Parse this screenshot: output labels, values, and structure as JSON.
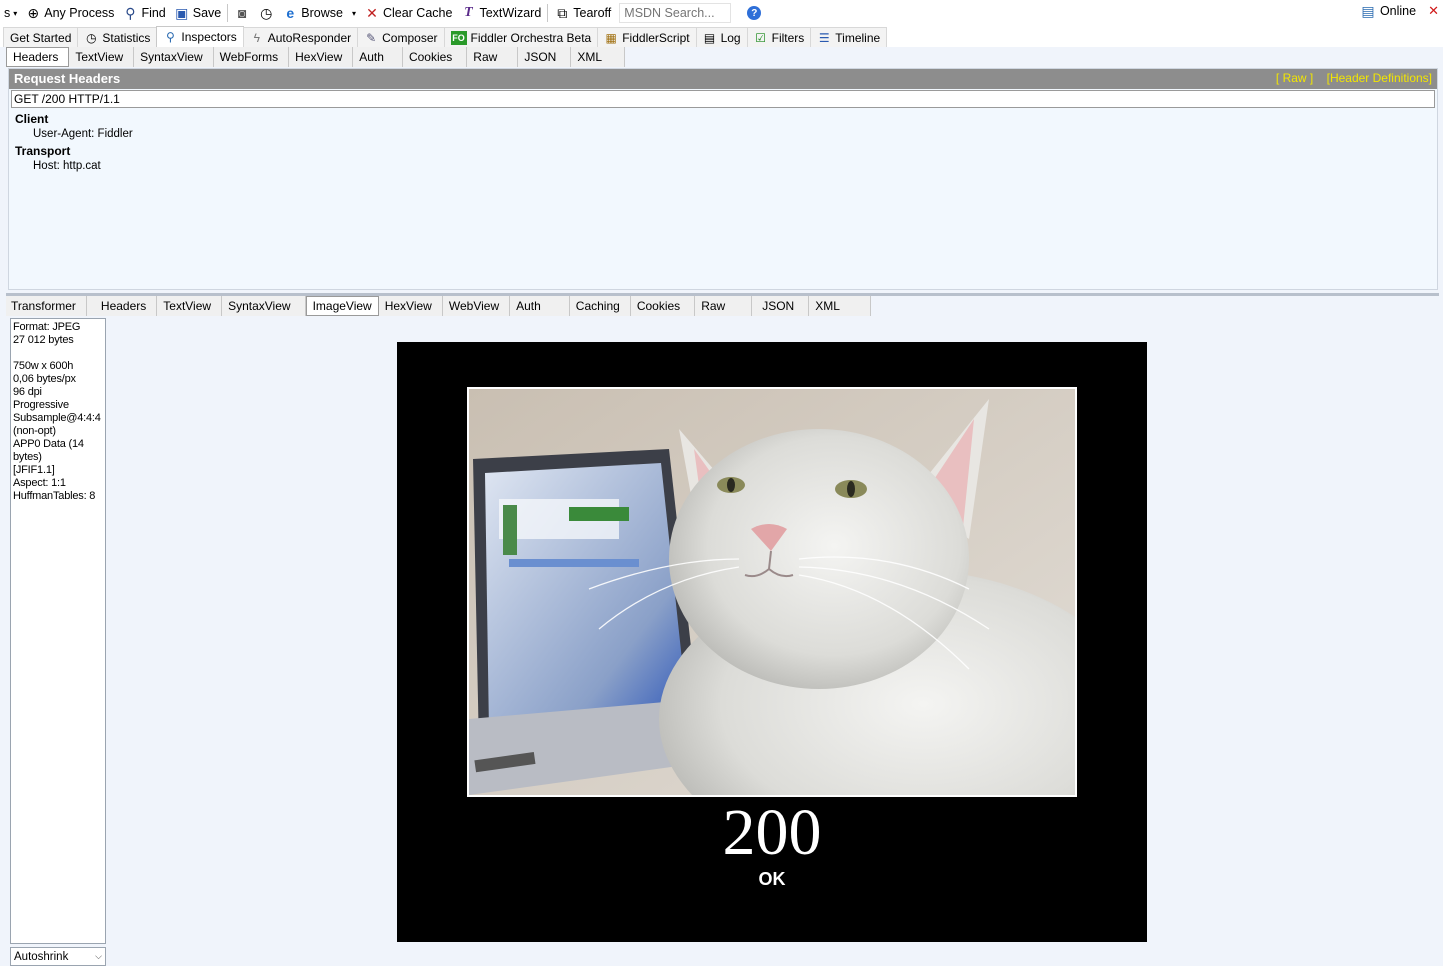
{
  "toolbar": {
    "cut_label": "s",
    "any_process": "Any Process",
    "find": "Find",
    "save": "Save",
    "browse": "Browse",
    "clear_cache": "Clear Cache",
    "text_wizard": "TextWizard",
    "tearoff": "Tearoff",
    "msdn_placeholder": "MSDN Search...",
    "online": "Online"
  },
  "main_tabs": [
    {
      "label": "Get Started"
    },
    {
      "label": "Statistics"
    },
    {
      "label": "Inspectors"
    },
    {
      "label": "AutoResponder"
    },
    {
      "label": "Composer"
    },
    {
      "label": "Fiddler Orchestra Beta",
      "icon": "FO"
    },
    {
      "label": "FiddlerScript"
    },
    {
      "label": "Log"
    },
    {
      "label": "Filters"
    },
    {
      "label": "Timeline"
    }
  ],
  "active_main_tab": "Inspectors",
  "request_tabs": [
    "Headers",
    "TextView",
    "SyntaxView",
    "WebForms",
    "HexView",
    "Auth",
    "Cookies",
    "Raw",
    "JSON",
    "XML"
  ],
  "active_request_tab": "Headers",
  "request_headers": {
    "title": "Request Headers",
    "raw_link": "[ Raw ]",
    "defs_link": "[Header Definitions]",
    "request_line": "GET /200 HTTP/1.1",
    "groups": [
      {
        "name": "Client",
        "items": [
          "User-Agent: Fiddler"
        ]
      },
      {
        "name": "Transport",
        "items": [
          "Host: http.cat"
        ]
      }
    ]
  },
  "response_tabs": [
    "Transformer",
    "Headers",
    "TextView",
    "SyntaxView",
    "ImageView",
    "HexView",
    "WebView",
    "Auth",
    "Caching",
    "Cookies",
    "Raw",
    "JSON",
    "XML"
  ],
  "active_response_tab": "ImageView",
  "image_info": [
    "Format: JPEG",
    "27 012 bytes",
    "",
    "750w x 600h",
    "0,06 bytes/px",
    "96 dpi",
    "Progressive",
    "Subsample@4:4:4",
    "(non-opt)",
    "APP0 Data (14",
    "bytes)",
    "[JFIF1.1]",
    "Aspect: 1:1",
    "HuffmanTables: 8"
  ],
  "autoshrink": "Autoshrink",
  "image": {
    "status_code": "200",
    "status_text": "OK"
  }
}
